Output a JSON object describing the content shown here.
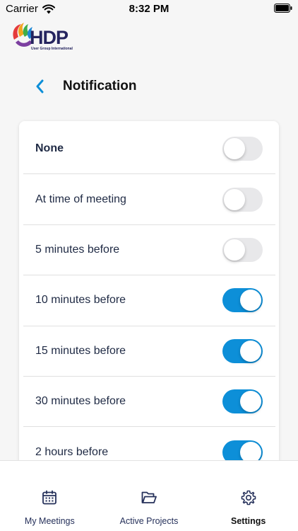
{
  "status_bar": {
    "carrier": "Carrier",
    "time": "8:32 PM"
  },
  "logo": {
    "name": "HDP",
    "tagline": "User Group International"
  },
  "header": {
    "title": "Notification"
  },
  "options": [
    {
      "label": "None",
      "enabled": false,
      "bold": true
    },
    {
      "label": "At time of meeting",
      "enabled": false,
      "bold": false
    },
    {
      "label": "5 minutes before",
      "enabled": false,
      "bold": false
    },
    {
      "label": "10 minutes before",
      "enabled": true,
      "bold": false
    },
    {
      "label": "15 minutes before",
      "enabled": true,
      "bold": false
    },
    {
      "label": "30 minutes before",
      "enabled": true,
      "bold": false
    },
    {
      "label": "2 hours before",
      "enabled": true,
      "bold": false
    }
  ],
  "tabs": [
    {
      "label": "My Meetings",
      "icon": "calendar-icon",
      "active": false
    },
    {
      "label": "Active Projects",
      "icon": "folder-icon",
      "active": false
    },
    {
      "label": "Settings",
      "icon": "gear-icon",
      "active": true
    }
  ],
  "colors": {
    "accent": "#0d8fd8",
    "toggle_off": "#e8e8ea",
    "text_primary": "#1f2a44",
    "logo_navy": "#25245e"
  }
}
